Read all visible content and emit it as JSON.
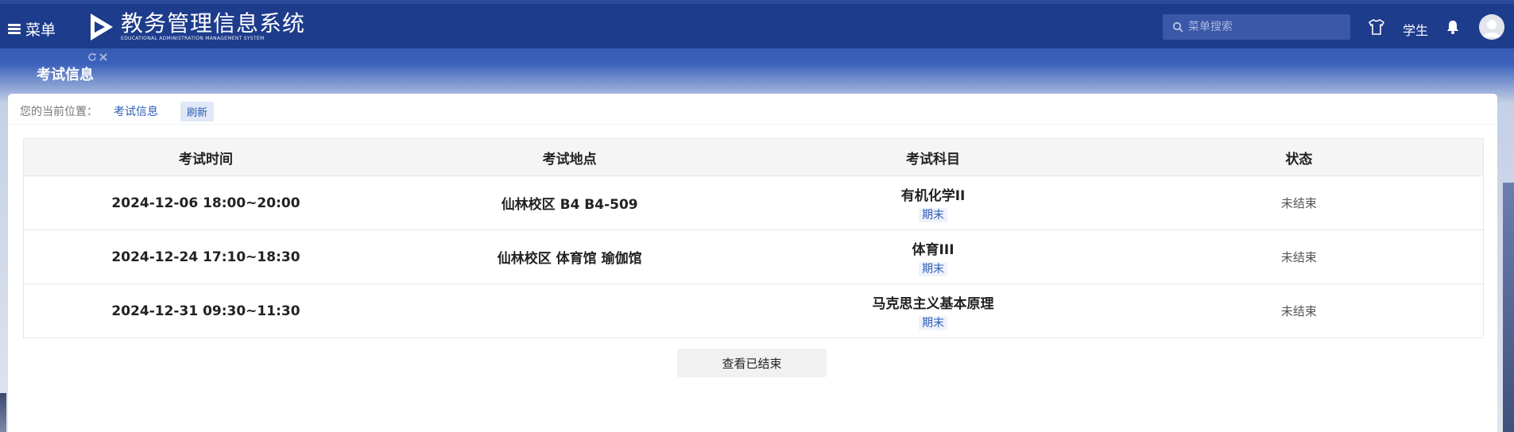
{
  "header": {
    "menu_label": "菜单",
    "app_title": "教务管理信息系统",
    "app_subtitle": "EDUCATIONAL ADMINISTRATION MANAGEMENT SYSTEM",
    "search_placeholder": "菜单搜索",
    "role_label": "学生"
  },
  "tabs": [
    {
      "label": "考试信息"
    }
  ],
  "breadcrumb": {
    "prefix": "您的当前位置：",
    "current": "考试信息",
    "refresh": "刷新"
  },
  "table": {
    "headers": [
      "考试时间",
      "考试地点",
      "考试科目",
      "状态"
    ],
    "rows": [
      {
        "time": "2024-12-06 18:00~20:00",
        "place": "仙林校区 B4 B4-509",
        "course": "有机化学II",
        "type": "期末",
        "status": "未结束"
      },
      {
        "time": "2024-12-24 17:10~18:30",
        "place": "仙林校区 体育馆 瑜伽馆",
        "course": "体育III",
        "type": "期末",
        "status": "未结束"
      },
      {
        "time": "2024-12-31 09:30~11:30",
        "place": "",
        "course": "马克思主义基本原理",
        "type": "期末",
        "status": "未结束"
      }
    ]
  },
  "view_finished_button": "查看已结束",
  "colors": {
    "header_bg": "#1e3c8c",
    "accent": "#2c5db8"
  },
  "icons": {
    "menu": "hamburger-icon",
    "logo": "play-logo-icon",
    "search": "search-icon",
    "theme": "shirt-icon",
    "notifications": "bell-icon",
    "tab_refresh": "refresh-icon",
    "tab_close": "close-icon"
  }
}
